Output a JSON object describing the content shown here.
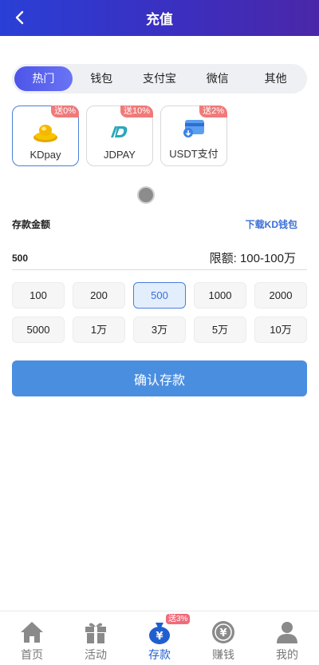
{
  "header": {
    "title": "充值"
  },
  "tabs": [
    {
      "label": "热门",
      "active": true
    },
    {
      "label": "钱包",
      "active": false
    },
    {
      "label": "支付宝",
      "active": false
    },
    {
      "label": "微信",
      "active": false
    },
    {
      "label": "其他",
      "active": false
    }
  ],
  "payments": [
    {
      "name": "KDpay",
      "badge": "送0%",
      "icon": "gold-ingot-icon"
    },
    {
      "name": "JDPAY",
      "badge": "送10%",
      "icon": "jdpay-logo-icon"
    },
    {
      "name": "USDT支付",
      "badge": "送2%",
      "icon": "card-wallet-icon"
    }
  ],
  "form": {
    "amount_label": "存款金额",
    "download_link": "下载KD钱包",
    "amount_value": "500",
    "limit_text": "限额: 100-100万"
  },
  "amounts": [
    "100",
    "200",
    "500",
    "1000",
    "2000",
    "5000",
    "1万",
    "3万",
    "5万",
    "10万"
  ],
  "selected_amount": "500",
  "confirm_label": "确认存款",
  "tabbar": [
    {
      "label": "首页",
      "icon": "home-icon"
    },
    {
      "label": "活动",
      "icon": "gift-icon"
    },
    {
      "label": "存款",
      "icon": "money-bag-icon",
      "badge": "送3%"
    },
    {
      "label": "赚钱",
      "icon": "coin-icon"
    },
    {
      "label": "我的",
      "icon": "user-icon"
    }
  ],
  "colors": {
    "header_start": "#2a3fd6",
    "header_end": "#4a27a8",
    "accent": "#4a8ee0",
    "badge": "#f07a7a",
    "active_tab": "#1f5fd0"
  }
}
